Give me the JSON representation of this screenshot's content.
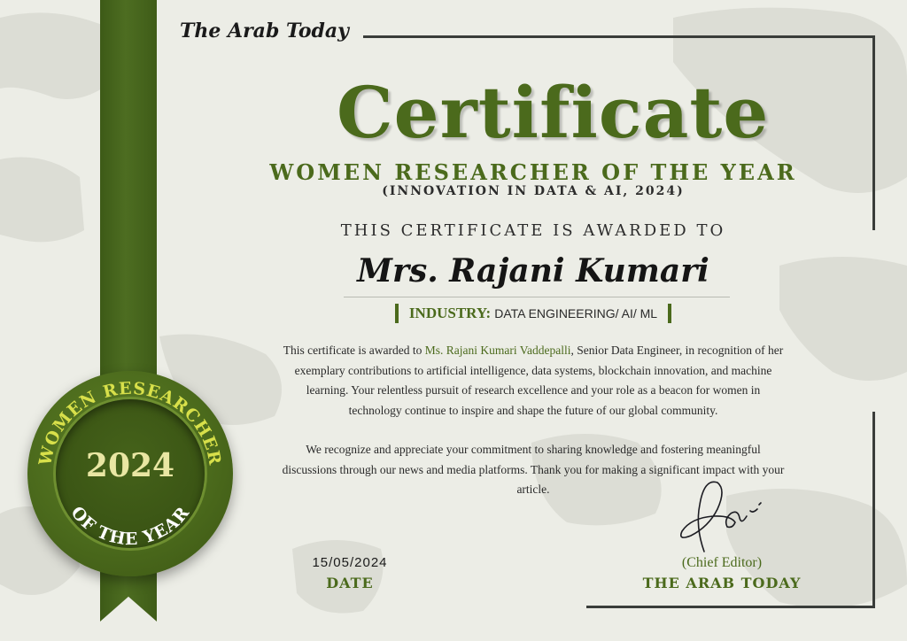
{
  "brand": "The Arab Today",
  "certificate": {
    "title": "Certificate",
    "award_title": "WOMEN RESEARCHER OF THE YEAR",
    "award_subtitle": "(INNOVATION IN DATA & AI, 2024)",
    "awarded_to_label": "THIS CERTIFICATE IS AWARDED TO",
    "recipient": "Mrs. Rajani Kumari",
    "industry_label": "INDUSTRY:",
    "industry_value": "DATA ENGINEERING/ AI/ ML"
  },
  "body": {
    "para1_before": "This certificate is awarded to ",
    "para1_name": "Ms. Rajani Kumari Vaddepalli",
    "para1_after": ", Senior Data Engineer, in recognition of her exemplary contributions to artificial intelligence, data systems, blockchain innovation, and machine learning. Your relentless pursuit of research excellence and your role as a beacon for women in technology continue to inspire and shape the future of our global community.",
    "para2": "We recognize and appreciate your commitment to sharing knowledge and fostering meaningful discussions through our news and media platforms. Thank you for making a significant impact with your article."
  },
  "footer": {
    "date_value": "15/05/2024",
    "date_label": "DATE",
    "signer_role": "(Chief Editor)",
    "signer_org": "THE ARAB TODAY"
  },
  "seal": {
    "top_text": "WOMEN RESEARCHER",
    "year": "2024",
    "bottom_text": "OF THE YEAR"
  },
  "colors": {
    "accent_green": "#4b6a1c",
    "ribbon_green": "#3d5a17",
    "seal_text": "#e9e6a3",
    "background": "#ecede6"
  }
}
